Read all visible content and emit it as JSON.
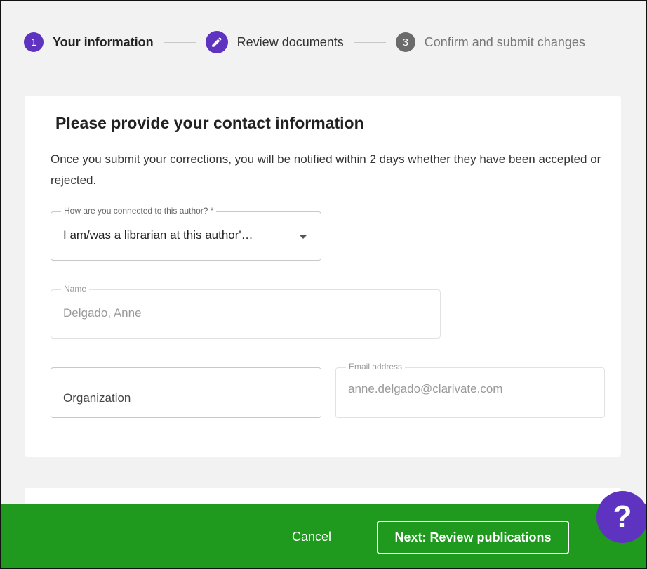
{
  "stepper": {
    "steps": [
      {
        "marker": "1",
        "label": "Your information"
      },
      {
        "marker": "",
        "label": "Review documents"
      },
      {
        "marker": "3",
        "label": "Confirm and submit changes"
      }
    ]
  },
  "form": {
    "heading": "Please provide your contact information",
    "description": "Once you submit your corrections, you will be notified within 2 days whether they have been accepted or rejected.",
    "connection": {
      "label": "How are you connected to this author? *",
      "value": "I am/was a librarian at this author'…"
    },
    "name": {
      "label": "Name",
      "value": "Delgado, Anne"
    },
    "organization": {
      "placeholder": "Organization"
    },
    "email": {
      "label": "Email address",
      "value": "anne.delgado@clarivate.com"
    }
  },
  "footer": {
    "cancel_label": "Cancel",
    "next_label": "Next: Review publications"
  },
  "help": {
    "label": "?"
  },
  "colors": {
    "accent": "#5e33bf",
    "footer": "#1f9a1f"
  }
}
